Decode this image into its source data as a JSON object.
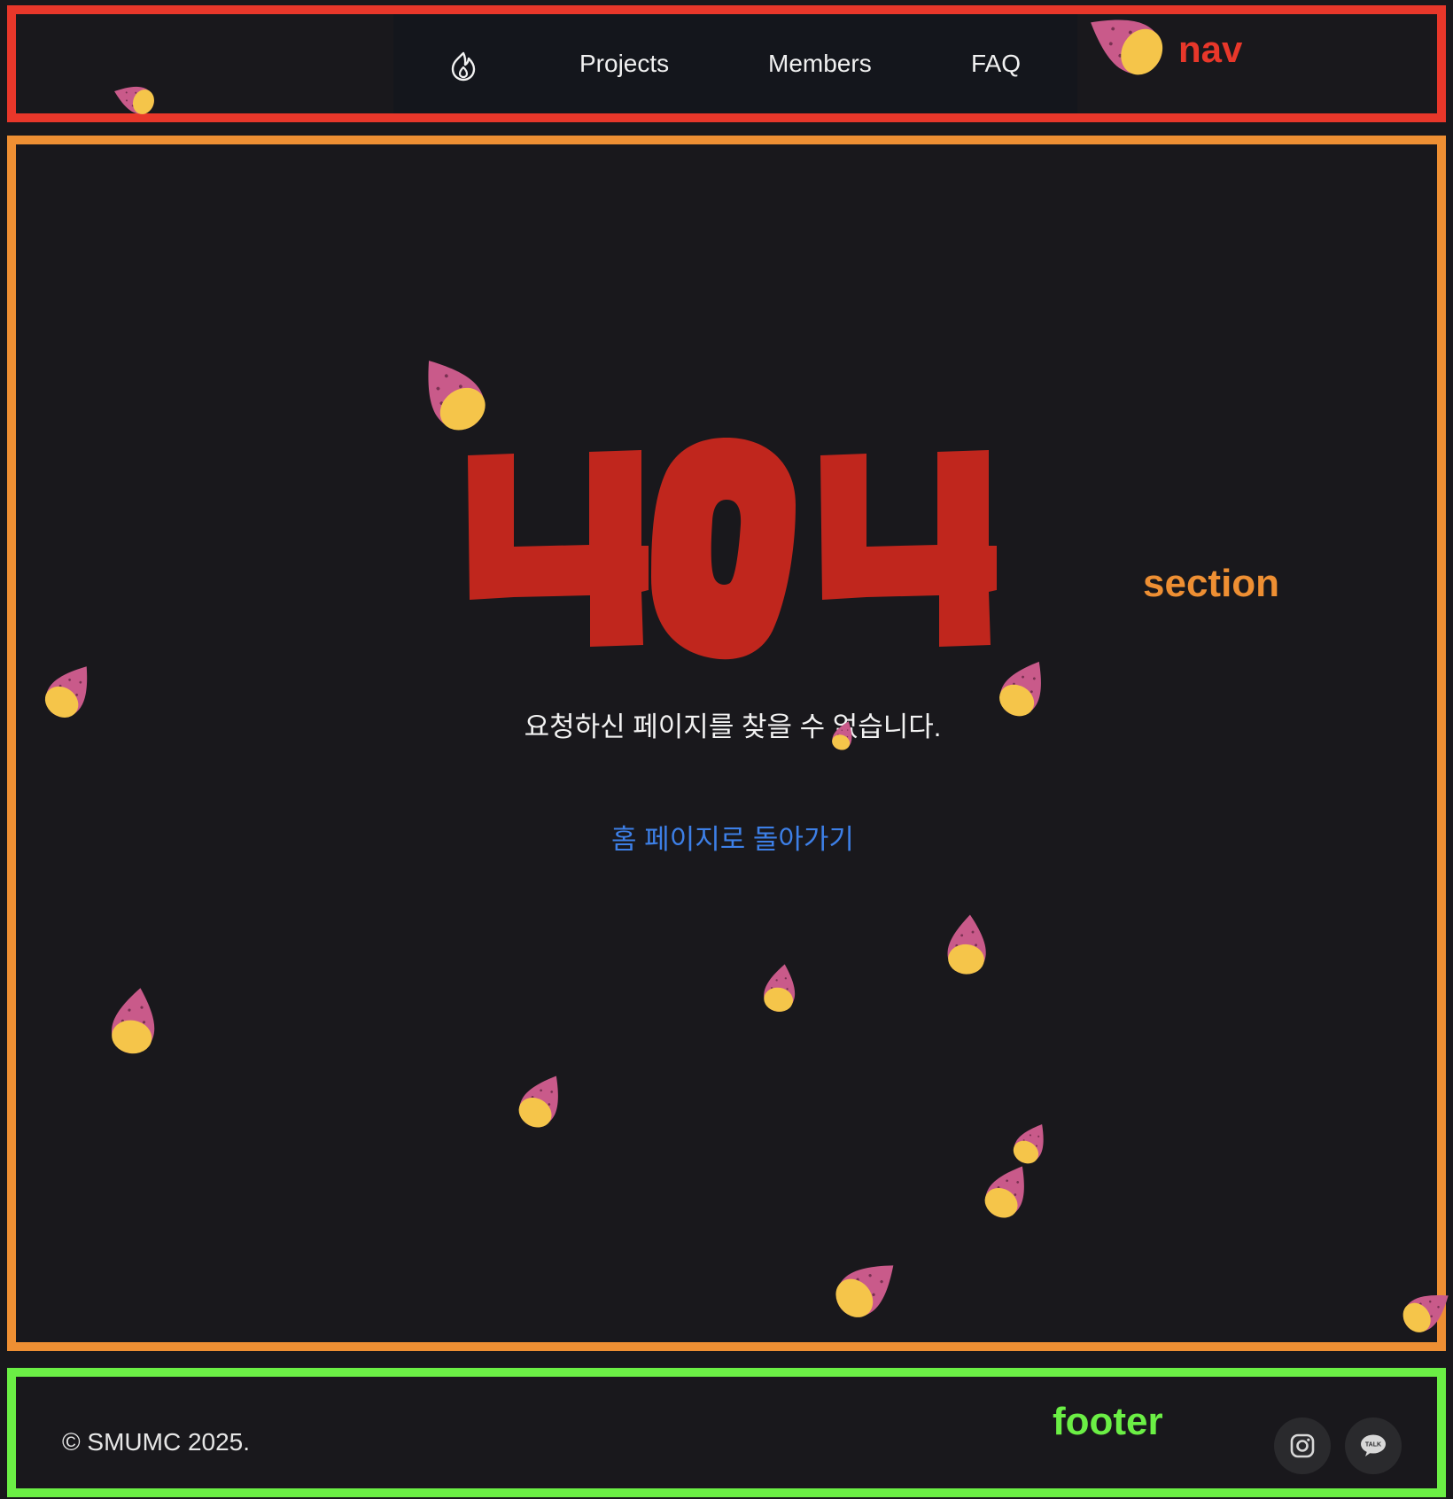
{
  "nav": {
    "logo_icon": "flame-icon",
    "links": [
      {
        "label": "Projects"
      },
      {
        "label": "Members"
      },
      {
        "label": "FAQ"
      }
    ]
  },
  "annotations": {
    "nav": "nav",
    "section": "section",
    "footer": "footer"
  },
  "main": {
    "error_code": "404",
    "message": "요청하신 페이지를 찾을 수 없습니다.",
    "home_link": "홈 페이지로 돌아가기"
  },
  "footer": {
    "copyright": "© SMUMC 2025.",
    "social": [
      {
        "icon": "instagram-icon"
      },
      {
        "icon": "kakaotalk-icon",
        "text": "TALK"
      }
    ]
  },
  "colors": {
    "background": "#19181c",
    "error_red": "#c0261d",
    "link_blue": "#3d7fe6",
    "potato_skin": "#c95a8a",
    "potato_flesh": "#f5c54a"
  }
}
